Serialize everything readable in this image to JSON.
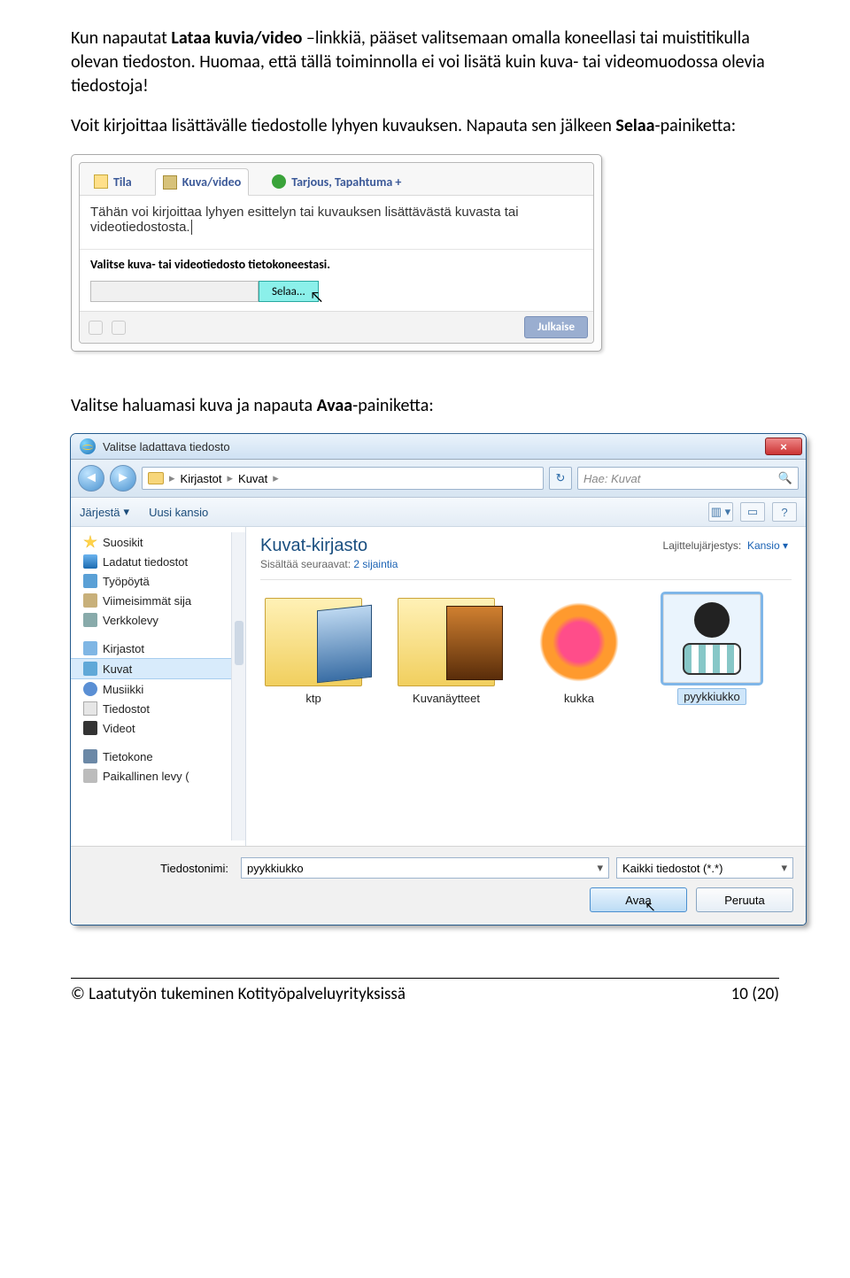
{
  "para1": {
    "pre": "Kun napautat ",
    "bold": "Lataa kuvia/video",
    "post": " –linkkiä, pääset valitsemaan omalla koneellasi tai muistitikulla olevan tiedoston. Huomaa, että tällä toiminnolla ei voi lisätä kuin kuva- tai videomuodossa olevia tiedostoja!"
  },
  "para2": {
    "pre": "Voit kirjoittaa lisättävälle tiedostolle lyhyen kuvauksen. Napauta sen jälkeen ",
    "bold": "Selaa",
    "post": "-painiketta:"
  },
  "composer": {
    "tabs": {
      "status": "Tila",
      "photo": "Kuva/video",
      "offer": "Tarjous, Tapahtuma +"
    },
    "text": "Tähän voi kirjoittaa lyhyen esittelyn tai kuvauksen lisättävästä kuvasta tai videotiedostosta.",
    "select_title": "Valitse kuva- tai videotiedosto tietokoneestasi.",
    "browse": "Selaa...",
    "publish": "Julkaise"
  },
  "para3": {
    "pre": "Valitse haluamasi kuva ja napauta ",
    "bold": "Avaa",
    "post": "-painiketta:"
  },
  "dialog": {
    "title": "Valitse ladattava tiedosto",
    "close": "×",
    "breadcrumb": {
      "root": "Kirjastot",
      "sub": "Kuvat"
    },
    "search_placeholder": "Hae: Kuvat",
    "toolbar": {
      "organize": "Järjestä",
      "newfolder": "Uusi kansio"
    },
    "nav": {
      "favorites": "Suosikit",
      "downloads": "Ladatut tiedostot",
      "desktop": "Työpöytä",
      "recent": "Viimeisimmät sija",
      "network": "Verkkolevy",
      "libraries": "Kirjastot",
      "pictures": "Kuvat",
      "music": "Musiikki",
      "documents": "Tiedostot",
      "videos": "Videot",
      "computer": "Tietokone",
      "localdisk": "Paikallinen levy ("
    },
    "content": {
      "lib_title": "Kuvat-kirjasto",
      "lib_sub_pre": "Sisältää seuraavat:  ",
      "lib_sub_link": "2 sijaintia",
      "sort_label": "Lajittelujärjestys:",
      "sort_value": "Kansio",
      "items": {
        "ktp": "ktp",
        "samples": "Kuvanäytteet",
        "kukka": "kukka",
        "pyykkiukko": "pyykkiukko"
      }
    },
    "footer": {
      "filename_label": "Tiedostonimi:",
      "filename_value": "pyykkiukko",
      "filter": "Kaikki tiedostot (*.*)",
      "open": "Avaa",
      "cancel": "Peruuta"
    }
  },
  "doc_footer": {
    "left": "© Laatutyön tukeminen Kotityöpalveluyrityksissä",
    "right": "10 (20)"
  }
}
